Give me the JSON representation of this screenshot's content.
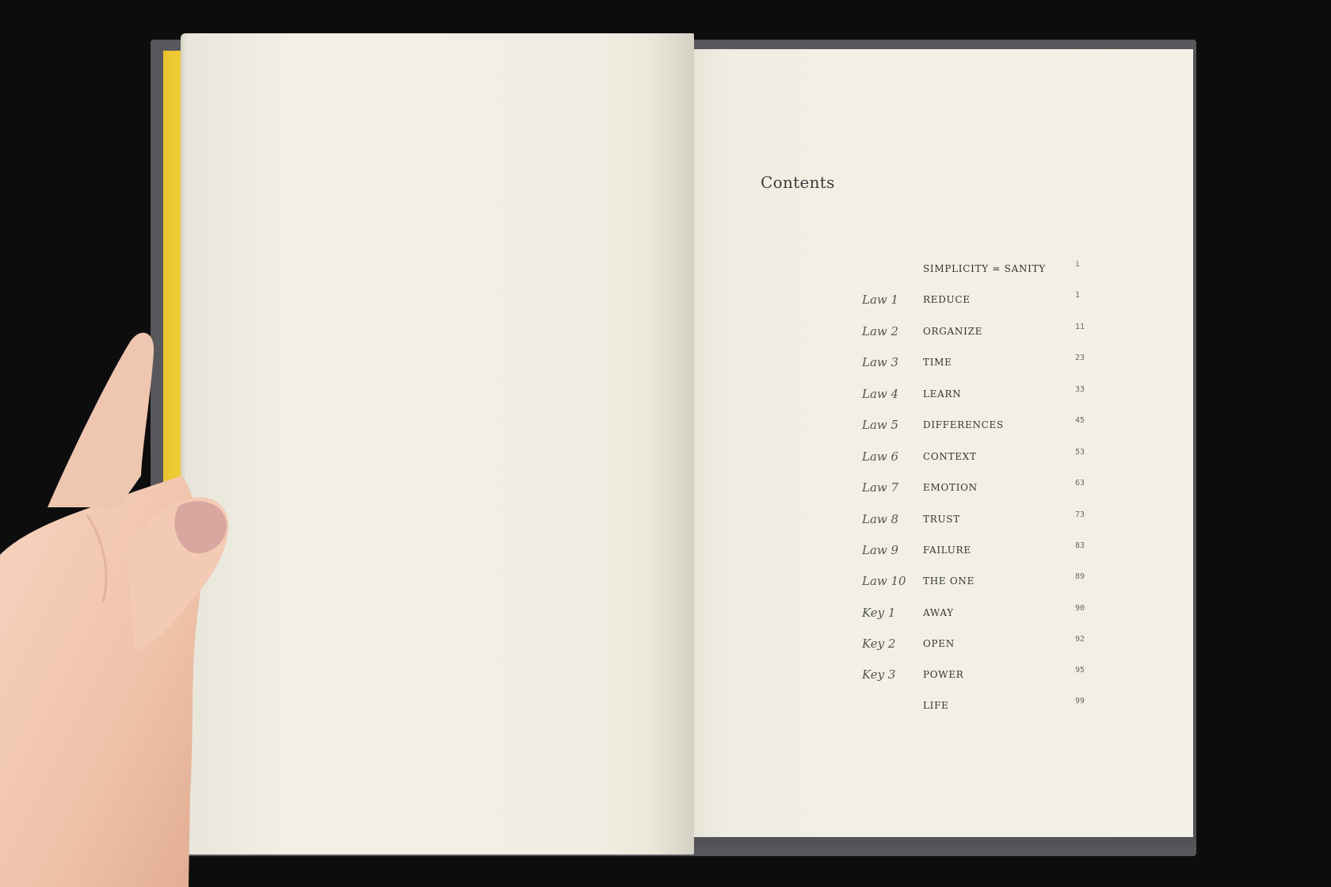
{
  "page_title": "Contents",
  "entries": [
    {
      "label": "",
      "title": "SIMPLICITY = SANITY",
      "page": "i"
    },
    {
      "label": "Law 1",
      "title": "REDUCE",
      "page": "1"
    },
    {
      "label": "Law 2",
      "title": "ORGANIZE",
      "page": "11"
    },
    {
      "label": "Law 3",
      "title": "TIME",
      "page": "23"
    },
    {
      "label": "Law 4",
      "title": "LEARN",
      "page": "33"
    },
    {
      "label": "Law 5",
      "title": "DIFFERENCES",
      "page": "45"
    },
    {
      "label": "Law 6",
      "title": "CONTEXT",
      "page": "53"
    },
    {
      "label": "Law 7",
      "title": "EMOTION",
      "page": "63"
    },
    {
      "label": "Law 8",
      "title": "TRUST",
      "page": "73"
    },
    {
      "label": "Law 9",
      "title": "FAILURE",
      "page": "83"
    },
    {
      "label": "Law 10",
      "title": "THE ONE",
      "page": "89"
    },
    {
      "label": "Key 1",
      "title": "AWAY",
      "page": "90"
    },
    {
      "label": "Key 2",
      "title": "OPEN",
      "page": "92"
    },
    {
      "label": "Key 3",
      "title": "POWER",
      "page": "95"
    },
    {
      "label": "",
      "title": "LIFE",
      "page": "99"
    }
  ],
  "colors": {
    "background": "#0d0d0d",
    "paper": "#f2f0e4",
    "yellow_endpaper": "#f0cf38",
    "cover": "#58585c",
    "skin": "#f0c4ad"
  },
  "icons": [
    "hand-holding-book"
  ]
}
